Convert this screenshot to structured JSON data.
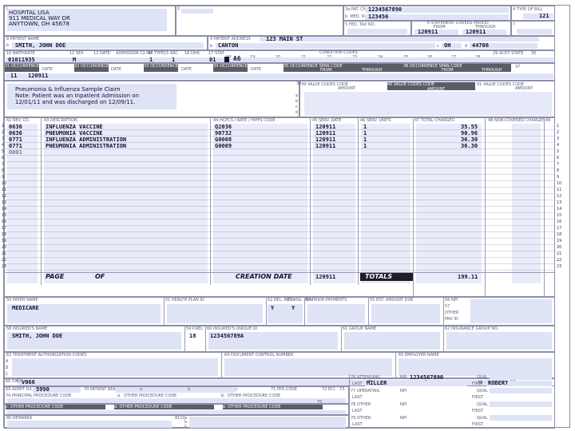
{
  "provider": {
    "name": "HOSPITAL USA",
    "address": "911 MEDICAL WAY DR",
    "city": "ANYTOWN, OH 45678"
  },
  "header": {
    "field_1_label": "1",
    "field_2_label": "2",
    "pat_cntl_label": "3a PAT. CNTL #",
    "med_rec_label": "b. MED. REC. #",
    "pat_cntl": "1234567890",
    "med_rec": "123456",
    "type_of_bill_label": "4 TYPE OF BILL",
    "type_of_bill": "121",
    "fed_tax_label": "5 FED. TAX NO.",
    "statement_label": "6 STATEMENT COVERS PERIOD",
    "from_label": "FROM",
    "through_label": "THROUGH",
    "from": "120911",
    "through": "120911",
    "field_7": "7"
  },
  "patient": {
    "name_label": "8 PATIENT NAME",
    "name_prefix": "b",
    "name": "SMITH, JOHN DOE",
    "address_label": "9 PATIENT ADDRESS",
    "street": "123 MAIN ST",
    "city_prefix": "b",
    "city": "CANTON",
    "state_prefix": "c",
    "state": "OH",
    "zip_prefix": "d",
    "zip": "44706"
  },
  "row10": {
    "labels": [
      "10 BIRTHDATE",
      "11 SEX",
      "12 DATE",
      "ADMISSION 13 HR",
      "14 TYPE",
      "15 SRC",
      "16 DHR",
      "17 STAT",
      "18",
      "19",
      "20",
      "21",
      "22",
      "23",
      "24",
      "25",
      "26",
      "27",
      "28",
      "29 ACDT STATE",
      "30"
    ],
    "condition_codes_label": "CONDITION CODES",
    "birthdate": "01011935",
    "sex": "M",
    "admission_type": "1",
    "admission_src": "1",
    "stat": "01",
    "condition_code": "A6"
  },
  "occurrence": {
    "labels": [
      "31 OCCURRENCE CODE",
      "DATE",
      "32 OCCURRENCE CODE",
      "DATE",
      "33 OCCURRENCE CODE",
      "DATE",
      "34 OCCURRENCE CODE",
      "DATE",
      "35 OCCURRENCE SPAN CODE",
      "FROM",
      "THROUGH",
      "36 OCCURRENCE SPAN CODE",
      "FROM",
      "THROUGH",
      "37"
    ],
    "code": "11",
    "date": "120911"
  },
  "remarks_box": {
    "line1": "Pneumonia & Influenza Sample Claim",
    "line2": "Note:  Patient was an Inpatient Admission on",
    "line3": "12/01/11 and was discharged on 12/09/11."
  },
  "value_codes": {
    "labels": [
      "38",
      "39 VALUE CODES CODE",
      "AMOUNT",
      "40 VALUE CODES CODE",
      "AMOUNT",
      "41 VALUE CODES CODE",
      "AMOUNT"
    ],
    "row_letters": [
      "a",
      "b",
      "c",
      "d"
    ]
  },
  "service_lines": {
    "headers": [
      "42 REV. CD.",
      "43 DESCRIPTION",
      "44 HCPCS / RATE / HIPPS CODE",
      "45 SERV. DATE",
      "46 SERV. UNITS",
      "47 TOTAL CHARGES",
      "48 NON-COVERED CHARGES",
      "49"
    ],
    "rows": [
      {
        "rev": "0636",
        "desc": "INFLUENZA VACCINE",
        "hcpcs": "Q2036",
        "date": "120911",
        "units": "1",
        "charge": "35.55"
      },
      {
        "rev": "0636",
        "desc": "PNEUMONIA VACCINE",
        "hcpcs": "90732",
        "date": "120911",
        "units": "1",
        "charge": "90.96"
      },
      {
        "rev": "0771",
        "desc": "INFLUENZA ADMINISTRATION",
        "hcpcs": "G0008",
        "date": "120911",
        "units": "1",
        "charge": "36.30"
      },
      {
        "rev": "0771",
        "desc": "PNEUMONIA ADMINISTRATION",
        "hcpcs": "G0009",
        "date": "120911",
        "units": "1",
        "charge": "36.30"
      },
      {
        "rev": "0001",
        "desc": "",
        "hcpcs": "",
        "date": "",
        "units": "",
        "charge": ""
      }
    ],
    "line_numbers": [
      "1",
      "2",
      "3",
      "4",
      "5",
      "6",
      "7",
      "8",
      "9",
      "10",
      "11",
      "12",
      "13",
      "14",
      "15",
      "16",
      "17",
      "18",
      "19",
      "20",
      "21",
      "22",
      "23"
    ],
    "page_label": "PAGE",
    "of_label": "OF",
    "creation_date_label": "CREATION DATE",
    "creation_date": "120911",
    "totals_label": "TOTALS",
    "total_charge": "199.11"
  },
  "payer": {
    "payer_name_label": "50 PAYER NAME",
    "health_plan_label": "51 HEALTH PLAN ID",
    "rel_info_label": "52 REL. INFO",
    "asg_ben_label": "53 ASG. BEN.",
    "prior_payments_label": "54 PRIOR PAYMENTS",
    "est_amount_label": "55 EST. AMOUNT DUE",
    "npi_label": "56 NPI",
    "other_label": "57",
    "other_text": "OTHER",
    "prv_id_label": "PRV ID",
    "payer": "MEDICARE",
    "rel_info": "Y",
    "asg_ben": "Y"
  },
  "insured": {
    "name_label": "58 INSURED'S NAME",
    "rel_label": "59 P.REL",
    "unique_id_label": "60 INSURED'S UNIQUE ID",
    "group_name_label": "61 GROUP NAME",
    "group_no_label": "62 INSURANCE GROUP NO.",
    "name": "SMITH, JOHN DOE",
    "rel": "18",
    "unique_id": "123456789A"
  },
  "treatment": {
    "auth_label": "63 TREATMENT AUTHORIZATION CODES",
    "doc_control_label": "64 DOCUMENT CONTROL NUMBER",
    "employer_label": "65 EMPLOYER NAME",
    "row_letters": [
      "A",
      "B",
      "C"
    ]
  },
  "diagnosis": {
    "dx_label": "66 DX",
    "dx_code": "V066",
    "field_67": "67",
    "letters": [
      "F",
      "G",
      "H"
    ],
    "field_68": "68"
  },
  "procedures": {
    "admit_dx_label": "69 ADMIT DX",
    "admit_dx": "5990",
    "patient_reason_label": "70 PATIENT REASON DX",
    "pps_code_label": "71 PPS CODE",
    "eci_label": "72 ECI",
    "field_73": "73",
    "reason_letters": [
      "a",
      "b",
      "c"
    ],
    "eci_letters": [
      "a",
      "b",
      "c"
    ],
    "principal_label": "74 PRINCIPAL PROCEDURE CODE",
    "date_label": "DATE",
    "other_proc_label": "OTHER PROCEDURE CODE",
    "other_letters": [
      "a.",
      "b.",
      "c.",
      "d.",
      "e."
    ],
    "field_75": "75"
  },
  "physicians": {
    "attending_label": "76 ATTENDING",
    "npi_label": "NPI",
    "attending_npi": "1234567890",
    "qual_label": "QUAL",
    "last_label": "LAST",
    "first_label": "FIRST",
    "attending_last": "MILLER",
    "attending_first": "ROBERT",
    "operating_label": "77 OPERATING",
    "other1_label": "78 OTHER",
    "other2_label": "79 OTHER"
  },
  "footer": {
    "remarks_label": "80 REMARKS",
    "cc_label": "81CC",
    "cc_letters": [
      "a",
      "b",
      "c",
      "d"
    ]
  },
  "colors": {
    "field_fill": "#dfe3f6",
    "header_dark": "#5c5c68",
    "border": "#8e8eaa"
  }
}
